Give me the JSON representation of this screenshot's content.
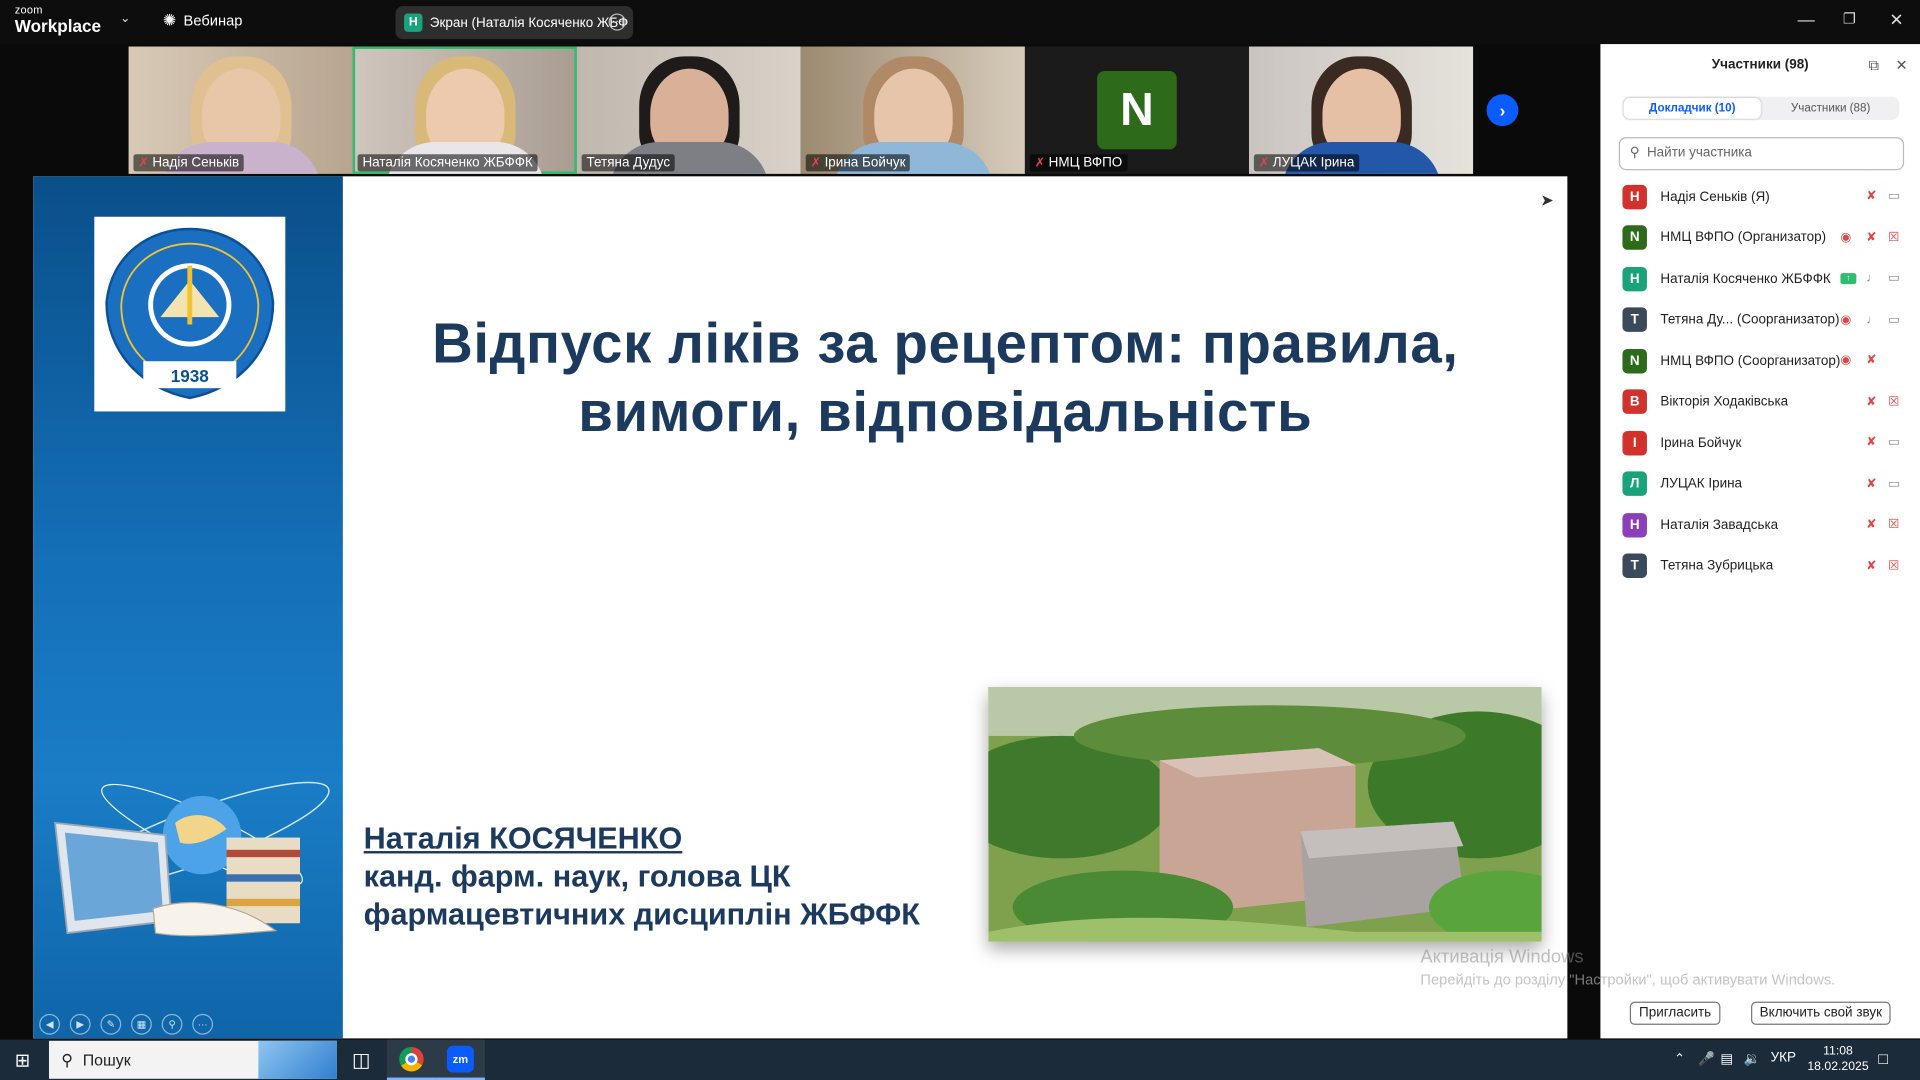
{
  "app": {
    "brand_top": "zoom",
    "brand_main": "Workplace",
    "webinar_label": "Вебинар",
    "screen_share_label": "Экран (Наталія Косяченко ЖБФ",
    "screen_share_initial": "Н"
  },
  "thumbnails": [
    {
      "name": "Надія Сеньків",
      "muted": true
    },
    {
      "name": "Наталія Косяченко ЖБФФК",
      "muted": false,
      "active": true
    },
    {
      "name": "Тетяна Дудус",
      "muted": false
    },
    {
      "name": "Ірина Бойчук",
      "muted": true
    },
    {
      "name": "НМЦ ВФПО",
      "muted": true,
      "avatar_letter": "N"
    },
    {
      "name": "ЛУЦАК Ірина",
      "muted": true
    }
  ],
  "slide": {
    "title_line1": "Відпуск ліків за рецептом: правила,",
    "title_line2": "вимоги, відповідальність",
    "speaker_name": "Наталія КОСЯЧЕНКО",
    "speaker_line2": "канд. фарм. наук, голова ЦК",
    "speaker_line3": "фармацевтичних дисциплін ЖБФФК",
    "logo_ring_text": "ЖИТОМИРСЬКИЙ БАЗОВИЙ ФАРМАЦЕВТИЧНИЙ ФАХОВИЙ КОЛЕДЖ",
    "logo_year": "1938"
  },
  "panel": {
    "title": "Участники (98)",
    "tab_presenters": "Докладчик (10)",
    "tab_attendees": "Участники (88)",
    "search_placeholder": "Найти участника",
    "participants": [
      {
        "initial": "Н",
        "color": "#d2322d",
        "name": "Надія Сеньків (Я)",
        "mic": "muted",
        "video": "on"
      },
      {
        "initial": "N",
        "color": "#2d6a1a",
        "name": "НМЦ ВФПО (Организатор)",
        "mic": "muted",
        "video": "off",
        "extra": "eye"
      },
      {
        "initial": "Н",
        "color": "#1aa37a",
        "name": "Наталія Косяченко ЖБФФК",
        "mic": "on",
        "video": "on",
        "extra": "share"
      },
      {
        "initial": "Т",
        "color": "#3b4a5a",
        "name": "Тетяна Ду...  (Соорганизатор)",
        "mic": "on",
        "video": "on",
        "extra": "eye"
      },
      {
        "initial": "N",
        "color": "#2d6a1a",
        "name": "НМЦ ВФПО (Соорганизатор)",
        "mic": "muted",
        "video": "none",
        "extra": "eye"
      },
      {
        "initial": "В",
        "color": "#d2322d",
        "name": "Вікторія Ходаківська",
        "mic": "muted",
        "video": "off"
      },
      {
        "initial": "І",
        "color": "#d2322d",
        "name": "Ірина Бойчук",
        "mic": "muted",
        "video": "on"
      },
      {
        "initial": "Л",
        "color": "#1aa37a",
        "name": "ЛУЦАК Ірина",
        "mic": "muted",
        "video": "on"
      },
      {
        "initial": "Н",
        "color": "#8a3fb8",
        "name": "Наталія Завадська",
        "mic": "muted",
        "video": "off"
      },
      {
        "initial": "Т",
        "color": "#3b4a5a",
        "name": "Тетяна Зубрицька",
        "mic": "muted",
        "video": "off"
      }
    ],
    "invite_button": "Пригласить",
    "unmute_button": "Включить свой звук"
  },
  "watermark": {
    "line1": "Активація Windows",
    "line2": "Перейдіть до розділу \"Настройки\", щоб активувати Windows."
  },
  "taskbar": {
    "search_label": "Пошук",
    "zoom_app_label": "zm",
    "lang": "УКР",
    "time": "11:08",
    "date": "18.02.2025"
  },
  "colors": {
    "accent": "#0b5cff",
    "slide_title": "#1c3a5e",
    "slide_band": "#1470b8",
    "active_speaker_border": "#2dbd6e",
    "muted_red": "#e24545"
  }
}
